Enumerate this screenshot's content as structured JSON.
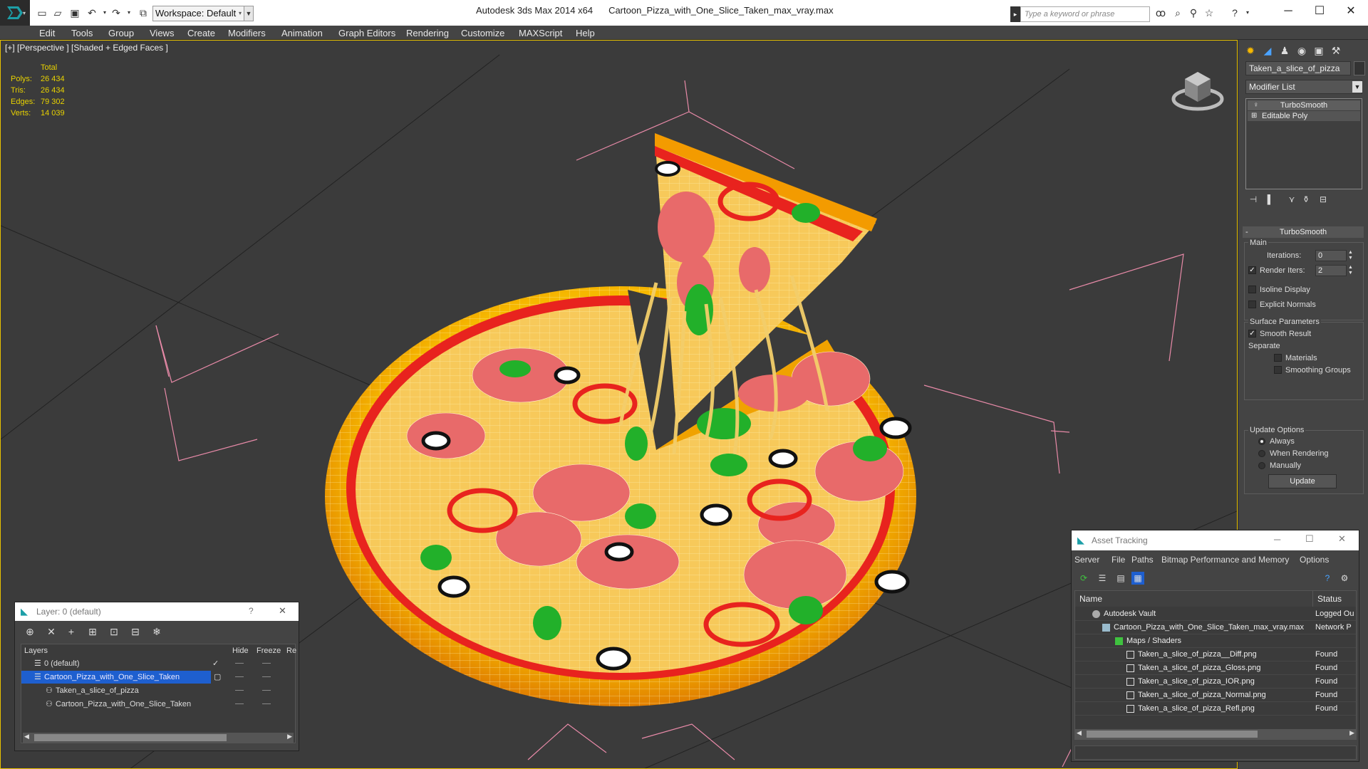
{
  "window": {
    "app_title": "Autodesk 3ds Max  2014 x64",
    "file_title": "Cartoon_Pizza_with_One_Slice_Taken_max_vray.max",
    "workspace": "Workspace: Default",
    "search_placeholder": "Type a keyword or phrase"
  },
  "menu": [
    "Edit",
    "Tools",
    "Group",
    "Views",
    "Create",
    "Modifiers",
    "Animation",
    "Graph Editors",
    "Rendering",
    "Customize",
    "MAXScript",
    "Help"
  ],
  "viewport": {
    "label": "[+] [Perspective ] [Shaded + Edged Faces ]",
    "stats_header": "Total",
    "stats": [
      {
        "label": "Polys:",
        "value": "26 434"
      },
      {
        "label": "Tris:",
        "value": "26 434"
      },
      {
        "label": "Edges:",
        "value": "79 302"
      },
      {
        "label": "Verts:",
        "value": "14 039"
      }
    ]
  },
  "command_panel": {
    "object_name": "Taken_a_slice_of_pizza",
    "modifier_list": "Modifier List",
    "stack": [
      "TurboSmooth",
      "Editable Poly"
    ],
    "rollout_title": "TurboSmooth",
    "main_label": "Main",
    "iterations_label": "Iterations:",
    "iterations_value": "0",
    "render_iters_label": "Render Iters:",
    "render_iters_value": "2",
    "isoline": "Isoline Display",
    "explicit_normals": "Explicit Normals",
    "surface_params": "Surface Parameters",
    "smooth_result": "Smooth Result",
    "separate": "Separate",
    "materials": "Materials",
    "smoothing_groups": "Smoothing Groups",
    "update_options": "Update Options",
    "always": "Always",
    "when_rendering": "When Rendering",
    "manually": "Manually",
    "update_button": "Update"
  },
  "layer_dialog": {
    "title": "Layer: 0 (default)",
    "help": "?",
    "close": "✕",
    "columns": [
      "Layers",
      "Hide",
      "Freeze",
      "Re"
    ],
    "rows": [
      "0 (default)",
      "Cartoon_Pizza_with_One_Slice_Taken",
      "Taken_a_slice_of_pizza",
      "Cartoon_Pizza_with_One_Slice_Taken"
    ]
  },
  "asset_dialog": {
    "title": "Asset Tracking",
    "menu": [
      "Server",
      "File",
      "Paths",
      "Bitmap Performance and Memory",
      "Options"
    ],
    "columns": [
      "Name",
      "Status"
    ],
    "rows": [
      {
        "name": "Autodesk Vault",
        "status": "Logged Ou"
      },
      {
        "name": "Cartoon_Pizza_with_One_Slice_Taken_max_vray.max",
        "status": "Network P"
      },
      {
        "name": "Maps / Shaders",
        "status": ""
      },
      {
        "name": "Taken_a_slice_of_pizza__Diff.png",
        "status": "Found"
      },
      {
        "name": "Taken_a_slice_of_pizza_Gloss.png",
        "status": "Found"
      },
      {
        "name": "Taken_a_slice_of_pizza_IOR.png",
        "status": "Found"
      },
      {
        "name": "Taken_a_slice_of_pizza_Normal.png",
        "status": "Found"
      },
      {
        "name": "Taken_a_slice_of_pizza_Refl.png",
        "status": "Found"
      }
    ]
  },
  "colors": {
    "viewport_bg": "#3b3b3b",
    "stats_yellow": "#e8d200",
    "selection_blue": "#1e5fcf",
    "crust": "#f2a400",
    "cheese": "#f7c95a",
    "sauce": "#e8231e",
    "pepperoni": "#e86a6a",
    "basil": "#22b02a"
  },
  "icons": [
    "app-logo-icon",
    "new-icon",
    "open-icon",
    "save-icon",
    "undo-icon",
    "redo-icon",
    "search-icon",
    "star-icon",
    "help-icon",
    "minimize-icon",
    "maximize-icon",
    "close-icon",
    "viewcube-icon"
  ]
}
